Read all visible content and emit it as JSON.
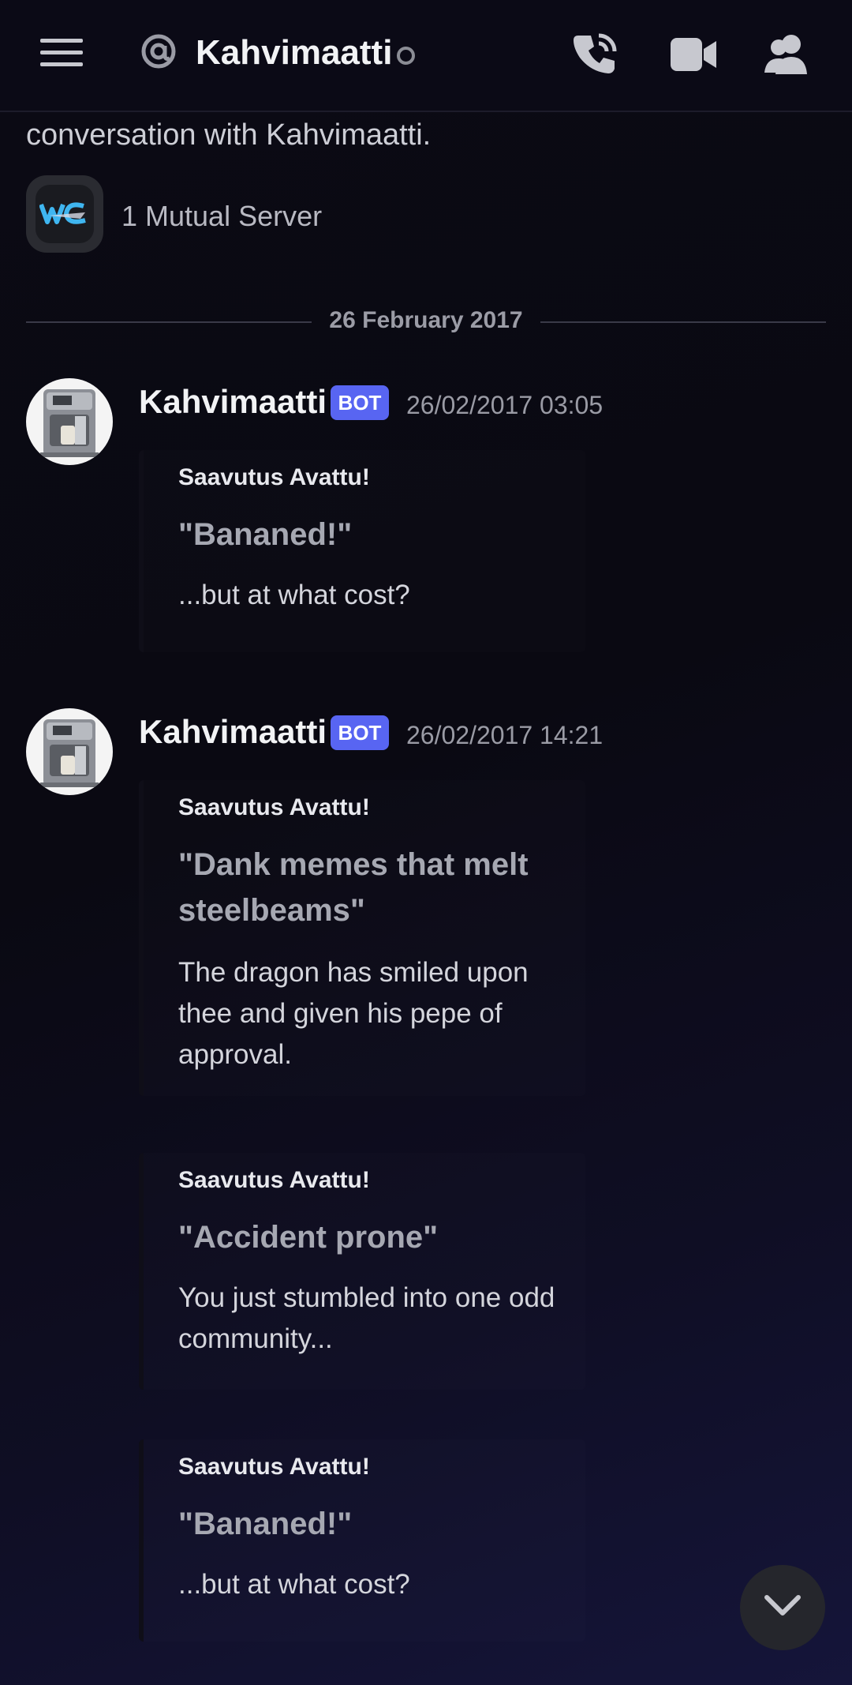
{
  "header": {
    "channel_name": "Kahvimaatti",
    "icons": {
      "menu": "hamburger-menu-icon",
      "at": "at-sign-icon",
      "call": "phone-call-icon",
      "video": "video-camera-icon",
      "members": "members-icon"
    }
  },
  "intro": {
    "text": "conversation with Kahvimaatti.",
    "mutual_servers": "1 Mutual Server"
  },
  "date_divider": "26 February 2017",
  "messages": [
    {
      "author": "Kahvimaatti",
      "badge": "BOT",
      "timestamp": "26/02/2017 03:05",
      "embeds": [
        {
          "author": "Saavutus Avattu!",
          "title": "\"Bananed!\"",
          "description": "...but at what cost?"
        }
      ]
    },
    {
      "author": "Kahvimaatti",
      "badge": "BOT",
      "timestamp": "26/02/2017 14:21",
      "embeds": [
        {
          "author": "Saavutus Avattu!",
          "title": "\"Dank memes that melt steelbeams\"",
          "description": "The dragon has smiled upon thee and given his pepe of approval."
        },
        {
          "author": "Saavutus Avattu!",
          "title": "\"Accident prone\"",
          "description": "You just stumbled into one odd community..."
        },
        {
          "author": "Saavutus Avattu!",
          "title": "\"Bananed!\"",
          "description": "...but at what cost?"
        }
      ]
    }
  ],
  "colors": {
    "background": "#0b0a14",
    "bot_badge": "#5865f2",
    "text_primary": "#f2f3f5"
  },
  "scroll_button_icon": "chevron-down-icon"
}
